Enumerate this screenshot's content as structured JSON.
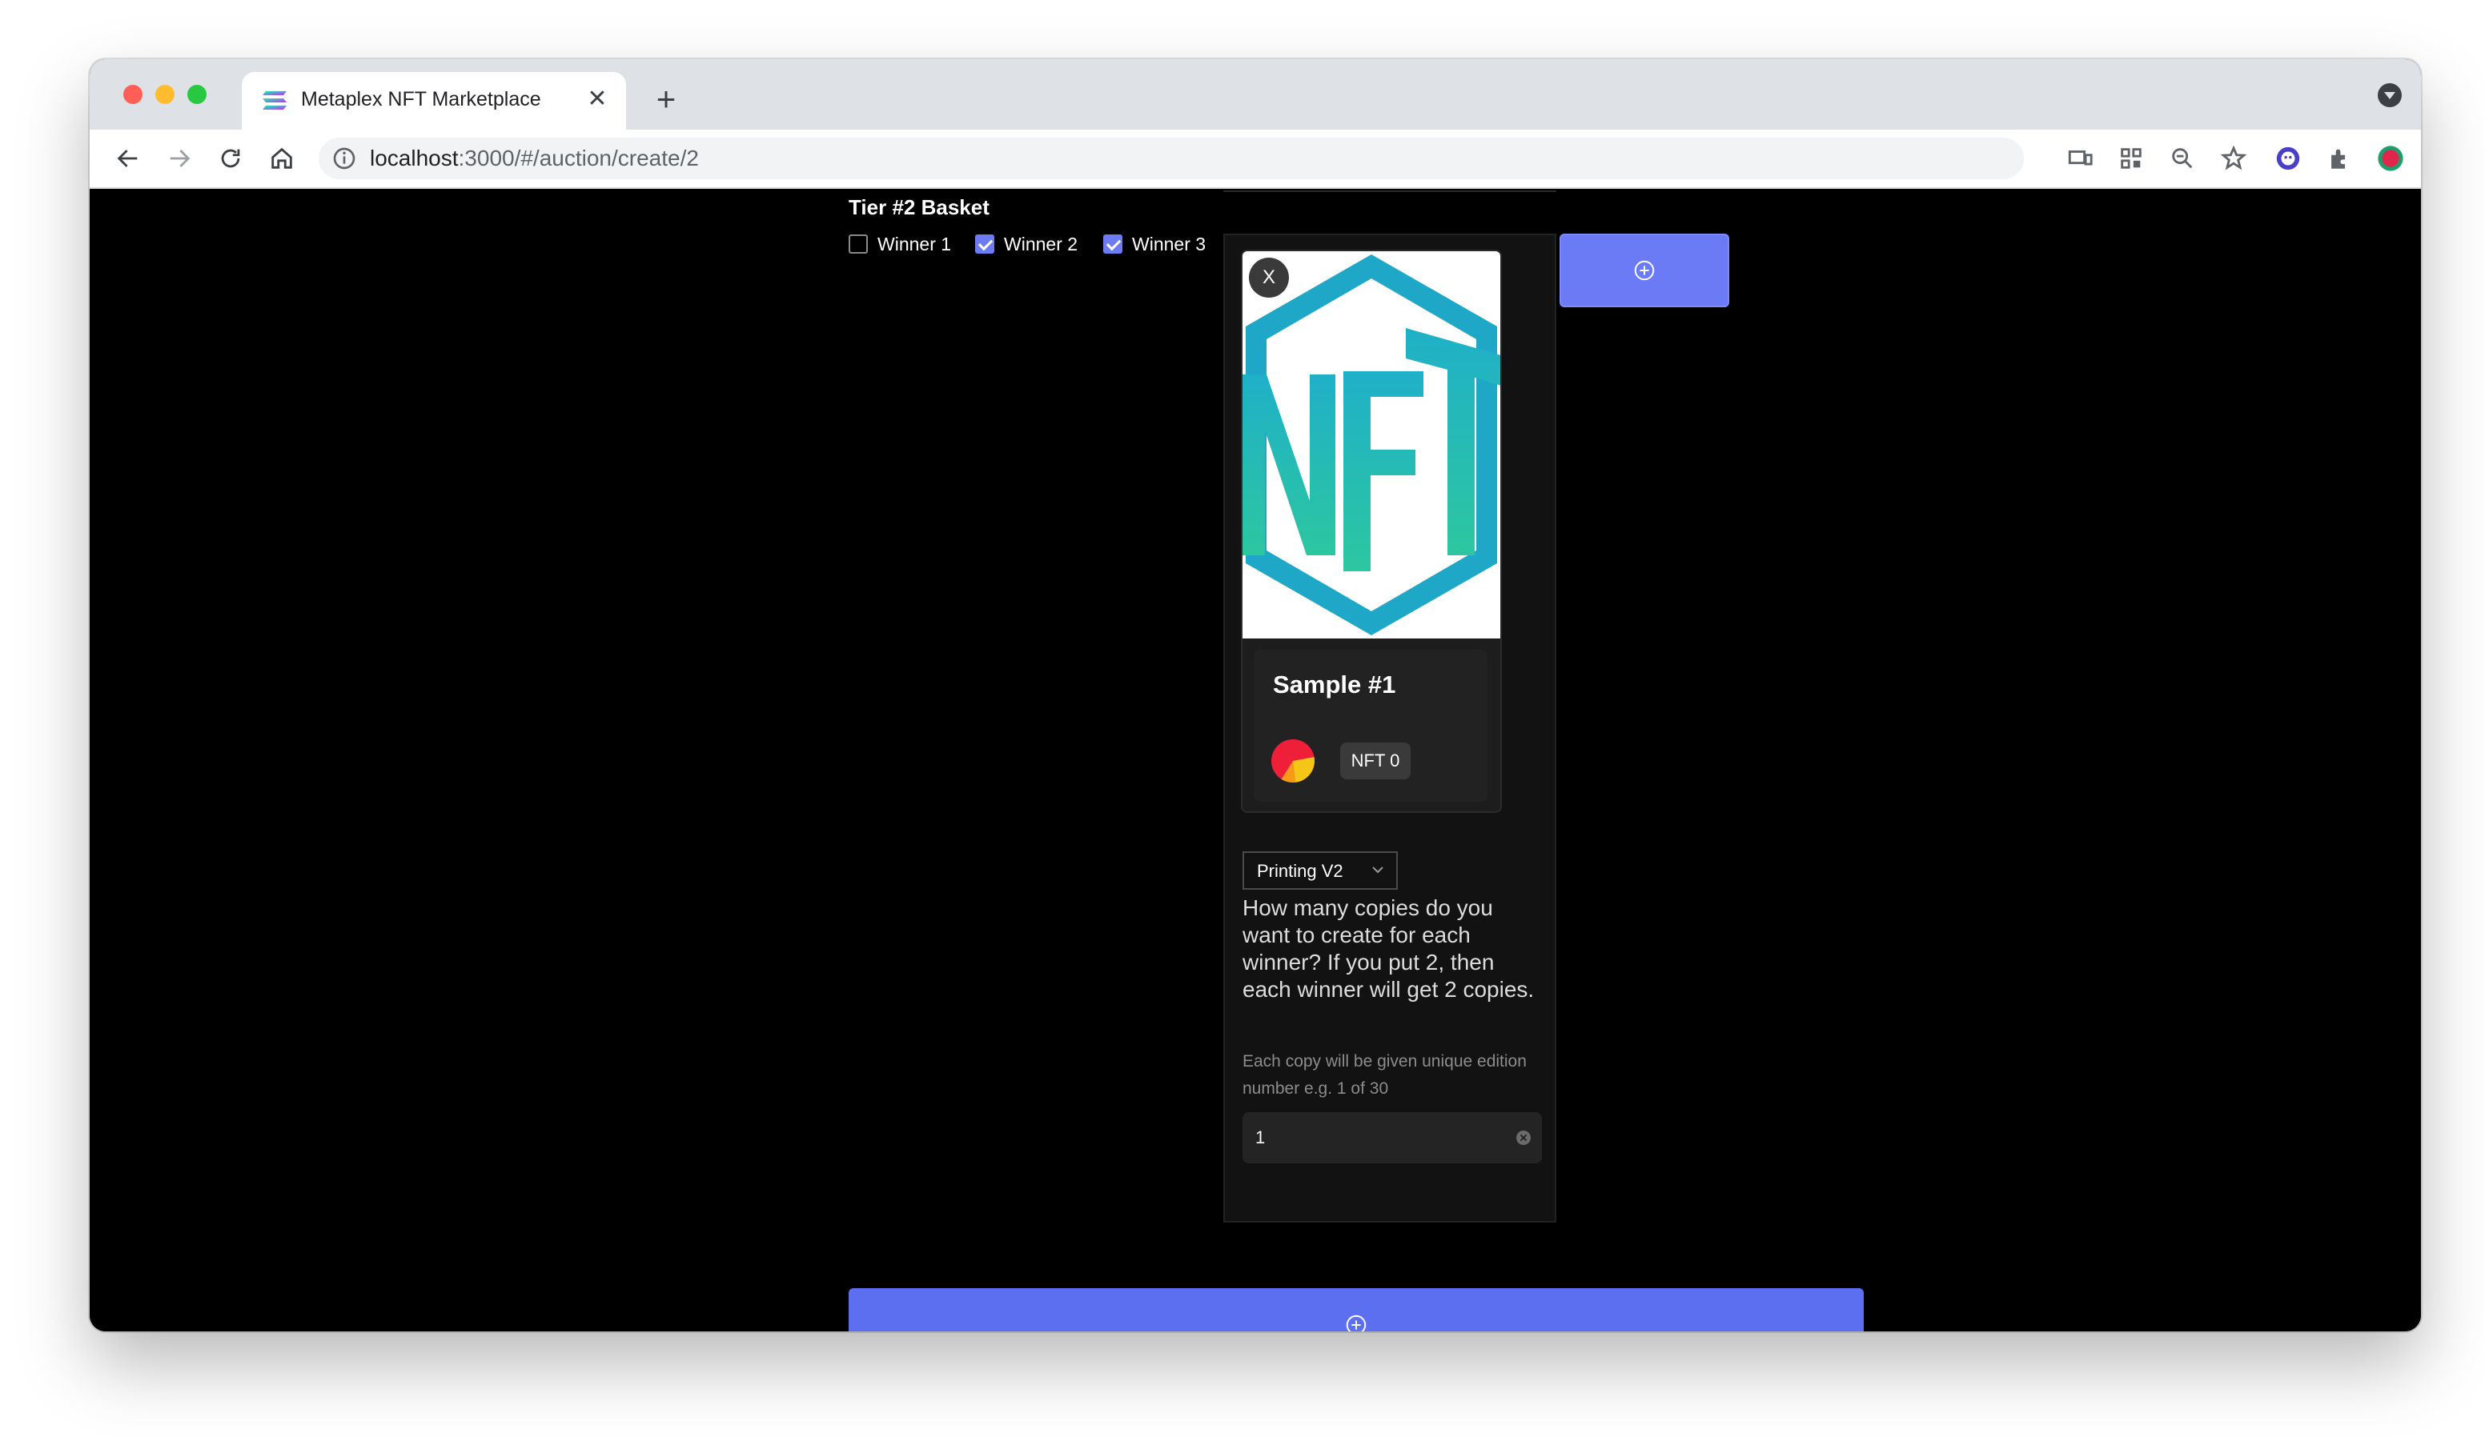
{
  "browser": {
    "tab_title": "Metaplex NFT Marketplace",
    "tab_close": "✕",
    "new_tab": "+",
    "url_host": "localhost",
    "url_path": ":3000/#/auction/create/2"
  },
  "tier": {
    "title": "Tier #2 Basket",
    "winners": [
      {
        "label": "Winner 1",
        "checked": false
      },
      {
        "label": "Winner 2",
        "checked": true
      },
      {
        "label": "Winner 3",
        "checked": true
      }
    ]
  },
  "item": {
    "remove_label": "X",
    "card_title": "Sample #1",
    "badge": "NFT 0",
    "edition_type": "Printing V2",
    "copies_question": "How many copies do you want to create for each winner? If you put 2, then each winner will get 2 copies.",
    "copies_hint": "Each copy will be given unique edition number e.g. 1 of 30",
    "copies_value": "1"
  },
  "colors": {
    "accent": "#5b6ff0",
    "nft_teal": "#1fb0c8",
    "nft_green": "#2cc7a0"
  }
}
